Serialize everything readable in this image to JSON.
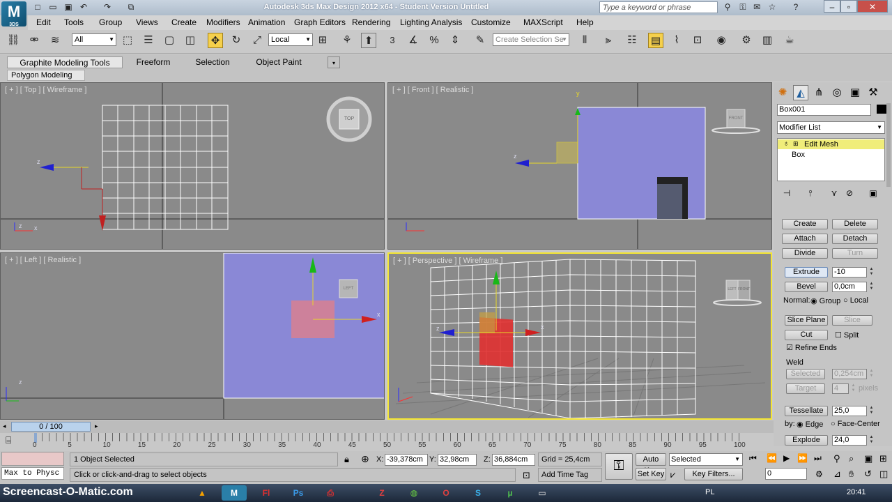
{
  "app": {
    "title": "Autodesk 3ds Max Design 2012 x64  - Student Version   Untitled",
    "logo_text": "3DS",
    "search_placeholder": "Type a keyword or phrase"
  },
  "menubar": [
    "Edit",
    "Tools",
    "Group",
    "Views",
    "Create",
    "Modifiers",
    "Animation",
    "Graph Editors",
    "Rendering",
    "Lighting Analysis",
    "Customize",
    "MAXScript",
    "Help"
  ],
  "toolbar": {
    "filter_select": "All",
    "ref_coord_select": "Local",
    "selection_set_placeholder": "Create Selection Se",
    "snap_number": "3"
  },
  "ribbon": {
    "tabs": [
      "Graphite Modeling Tools",
      "Freeform",
      "Selection",
      "Object Paint"
    ],
    "active_tab": "Graphite Modeling Tools",
    "subtab": "Polygon Modeling"
  },
  "viewports": {
    "top": {
      "label": "[ + ] [ Top ] [ Wireframe ]",
      "cube": "TOP"
    },
    "front": {
      "label": "[ + ] [ Front ] [ Realistic ]",
      "cube": "FRONT"
    },
    "left": {
      "label": "[ + ] [ Left ] [ Realistic ]",
      "cube": "LEFT"
    },
    "perspective": {
      "label": "[ + ] [ Perspective ] [ Wireframe ]",
      "cube_left": "LEFT",
      "cube_right": "FRONT"
    },
    "axis": {
      "x": "x",
      "y": "y",
      "z": "z"
    }
  },
  "command_panel": {
    "object_name": "Box001",
    "modifier_list": "Modifier List",
    "stack": [
      "Edit Mesh",
      "Box"
    ],
    "buttons": {
      "create": "Create",
      "delete": "Delete",
      "attach": "Attach",
      "detach": "Detach",
      "divide": "Divide",
      "turn": "Turn",
      "extrude": "Extrude",
      "bevel": "Bevel",
      "slice_plane": "Slice Plane",
      "slice": "Slice",
      "cut": "Cut",
      "selected": "Selected",
      "target": "Target",
      "tessellate": "Tessellate",
      "explode": "Explode"
    },
    "extrude_value": "-10",
    "bevel_value": "0,0cm",
    "normal_label": "Normal:",
    "normal_group": "Group",
    "normal_local": "Local",
    "split_label": "Split",
    "refine_ends_label": "Refine Ends",
    "weld_label": "Weld",
    "weld_selected_value": "0,254cm",
    "weld_target_value": "4",
    "pixels_label": "pixels",
    "tessellate_value": "25,0",
    "by_label": "by:",
    "by_edge": "Edge",
    "by_face_center": "Face-Center",
    "explode_value": "24,0"
  },
  "timeline": {
    "frame_display": "0 / 100",
    "ticks": [
      "0",
      "5",
      "10",
      "15",
      "20",
      "25",
      "30",
      "35",
      "40",
      "45",
      "50",
      "55",
      "60",
      "65",
      "70",
      "75",
      "80",
      "85",
      "90",
      "95",
      "100"
    ]
  },
  "status": {
    "maxscript_listener": "Max to Physc",
    "selection_info": "1 Object Selected",
    "prompt": "Click or click-and-drag to select objects",
    "x_label": "X:",
    "x_value": "-39,378cm",
    "y_label": "Y:",
    "y_value": "32,98cm",
    "z_label": "Z:",
    "z_value": "36,884cm",
    "grid": "Grid = 25,4cm",
    "add_time_tag": "Add Time Tag",
    "auto_key": "Auto Key",
    "set_key": "Set Key",
    "key_mode_select": "Selected",
    "key_filters": "Key Filters...",
    "frame_field": "0"
  },
  "taskbar": {
    "watermark": "Screencast-O-Matic.com",
    "language": "PL",
    "clock": "20:41"
  },
  "colors": {
    "viewport_bg": "#8a8a8a",
    "box_blue": "#8a88d6",
    "active_border": "#f5e632",
    "stack_highlight": "#f0ed7a"
  }
}
